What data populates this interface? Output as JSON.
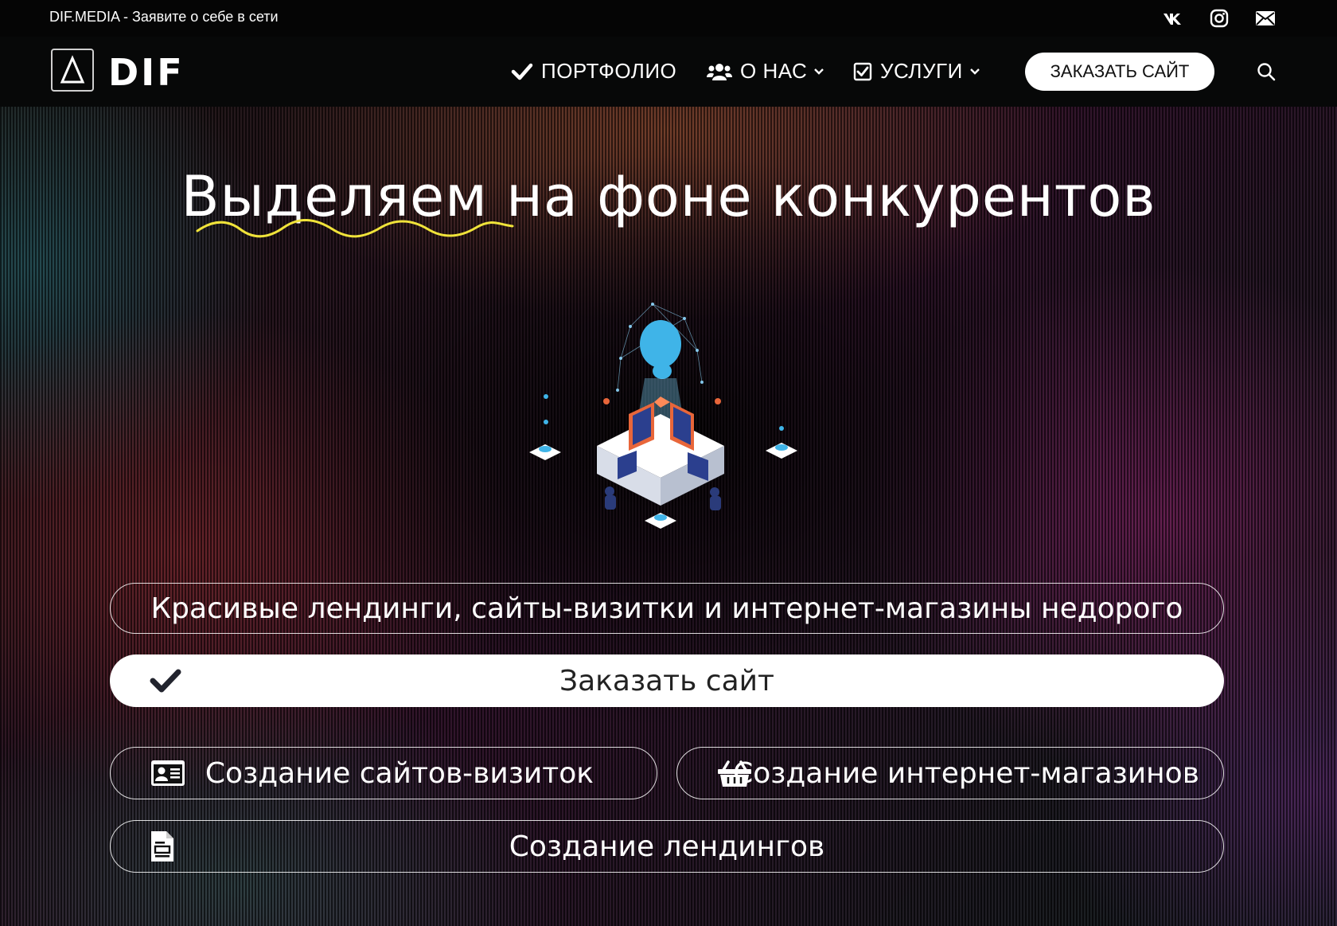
{
  "topbar": {
    "tagline": "DIF.MEDIA - Заявите о себе в сети",
    "social": [
      {
        "name": "vk-icon"
      },
      {
        "name": "instagram-icon"
      },
      {
        "name": "mail-icon"
      }
    ]
  },
  "navbar": {
    "logo_symbol": "Δ",
    "logo_text": "DIF",
    "items": [
      {
        "label": "ПОРТФОЛИО",
        "icon": "check-icon",
        "dropdown": false
      },
      {
        "label": "О НАС",
        "icon": "users-icon",
        "dropdown": true
      },
      {
        "label": "УСЛУГИ",
        "icon": "checkbox-icon",
        "dropdown": true
      }
    ],
    "order_button": "ЗАКАЗАТЬ САЙТ",
    "search_icon": "search-icon"
  },
  "hero": {
    "headline": "Выделяем на фоне конкурентов",
    "tagline_pill": "Красивые лендинги, сайты-визитки и интернет-магазины недорого",
    "cta": "Заказать сайт",
    "services": [
      {
        "label": "Создание сайтов-визиток",
        "icon": "id-card-icon"
      },
      {
        "label": "Создание интернет-магазинов",
        "icon": "basket-icon"
      },
      {
        "label": "Создание лендингов",
        "icon": "document-icon"
      }
    ]
  },
  "colors": {
    "accent_underline": "#f0e33a",
    "navbar_bg": "#070808",
    "topbar_bg": "#050505",
    "button_bg": "#ffffff"
  }
}
